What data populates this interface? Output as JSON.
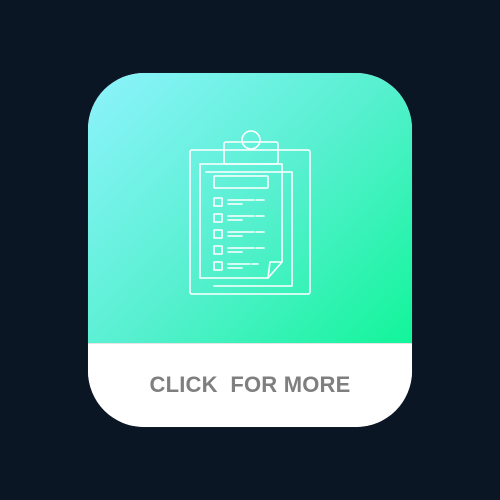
{
  "app_icon": {
    "icon": "clipboard-checklist-icon",
    "cta_label": "CLICK  FOR MORE",
    "colors": {
      "background": "#0b1624",
      "gradient_start": "#8ef3fd",
      "gradient_end": "#12f59a",
      "icon_stroke": "#ffffff",
      "label": "#7f7f7f"
    }
  }
}
